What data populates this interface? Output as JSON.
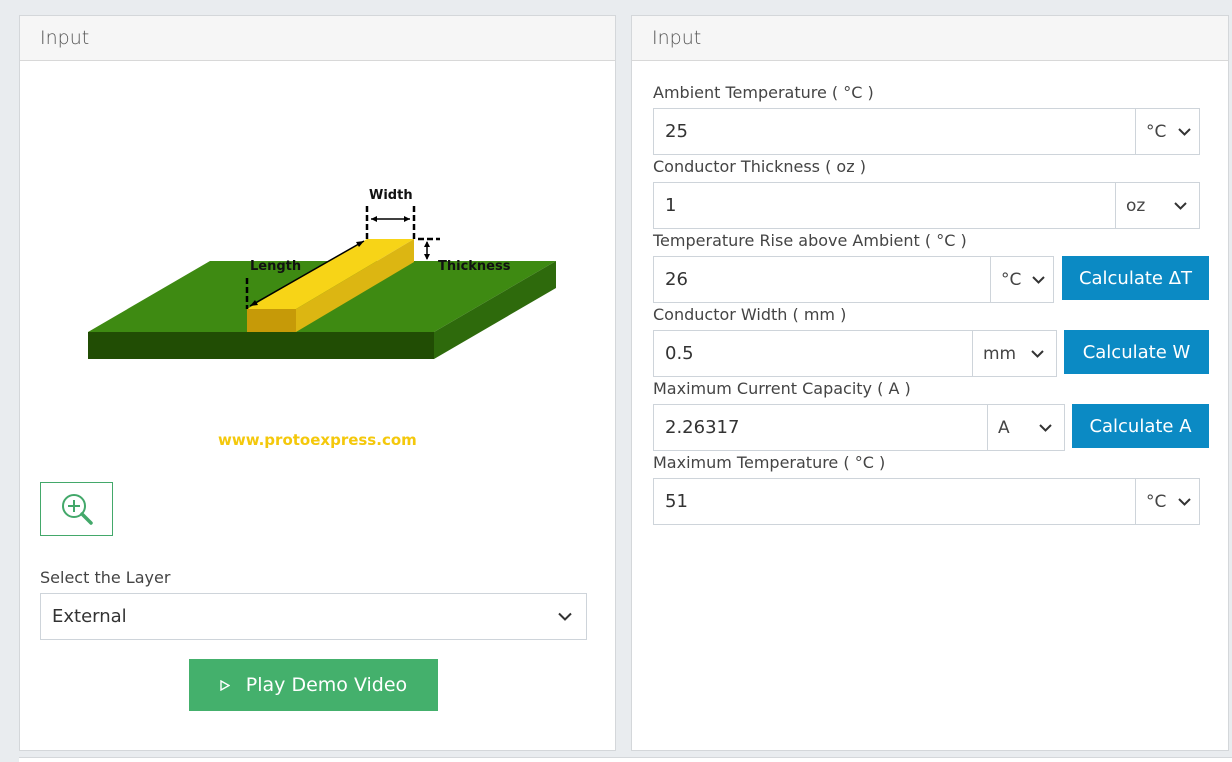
{
  "left_panel": {
    "header": "Input",
    "diagram": {
      "width_label": "Width",
      "length_label": "Length",
      "thickness_label": "Thickness",
      "website": "www.protoexpress.com"
    },
    "zoom_icon": "zoom-in-icon",
    "layer_label": "Select the Layer",
    "layer_value": "External",
    "demo_button": "Play Demo Video"
  },
  "right_panel": {
    "header": "Input",
    "fields": [
      {
        "label": "Ambient Temperature ( °C )",
        "value": "25",
        "unit": "°C"
      },
      {
        "label": "Conductor Thickness ( oz )",
        "value": "1",
        "unit": "oz"
      },
      {
        "label": "Temperature Rise above Ambient ( °C )",
        "value": "26",
        "unit": "°C",
        "button": "Calculate ΔT"
      },
      {
        "label": "Conductor Width ( mm )",
        "value": "0.5",
        "unit": "mm",
        "button": "Calculate W"
      },
      {
        "label": "Maximum Current Capacity ( A )",
        "value": "2.26317",
        "unit": "A",
        "button": "Calculate A"
      },
      {
        "label": "Maximum Temperature ( °C )",
        "value": "51",
        "unit": "°C"
      }
    ]
  },
  "colors": {
    "accent_blue": "#0b8ac4",
    "accent_green": "#44b06c",
    "board_green": "#3e8a12",
    "trace_yellow": "#f7d417"
  }
}
